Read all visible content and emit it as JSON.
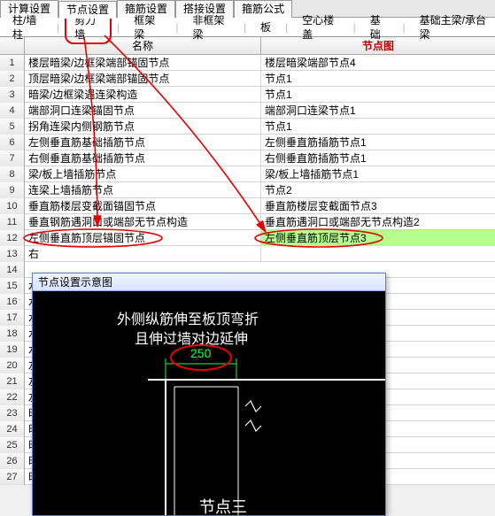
{
  "top_tabs": [
    "计算设置",
    "节点设置",
    "箍筋设置",
    "搭接设置",
    "箍筋公式"
  ],
  "top_active_index": 1,
  "sub_tabs": [
    "柱/墙柱",
    "剪力墙",
    "框架梁",
    "非框架梁",
    "板",
    "空心楼盖",
    "基础",
    "基础主梁/承台梁"
  ],
  "sub_active_index": 1,
  "grid": {
    "header_name": "名称",
    "header_node": "节点图",
    "rows": [
      {
        "n": 1,
        "name": "楼层暗梁/边框梁端部锚固节点",
        "node": "楼层暗梁端部节点4"
      },
      {
        "n": 2,
        "name": "顶层暗梁/边框梁端部锚固节点",
        "node": "节点1"
      },
      {
        "n": 3,
        "name": "暗梁/边框梁遇连梁构造",
        "node": "节点1"
      },
      {
        "n": 4,
        "name": "端部洞口连梁锚固节点",
        "node": "端部洞口连梁节点1"
      },
      {
        "n": 5,
        "name": "拐角连梁内侧钢筋节点",
        "node": "节点1"
      },
      {
        "n": 6,
        "name": "左侧垂直筋基础插筋节点",
        "node": "左侧垂直筋插筋节点1"
      },
      {
        "n": 7,
        "name": "右侧垂直筋基础插筋节点",
        "node": "右侧垂直筋插筋节点1"
      },
      {
        "n": 8,
        "name": "梁/板上墙插筋节点",
        "node": "梁/板上墙插筋节点1"
      },
      {
        "n": 9,
        "name": "连梁上墙插筋节点",
        "node": "节点2"
      },
      {
        "n": 10,
        "name": "垂直筋楼层变截面锚固节点",
        "node": "垂直筋楼层变截面节点3"
      },
      {
        "n": 11,
        "name": "垂直钢筋遇洞口或端部无节点构造",
        "node": "垂直筋遇洞口或端部无节点构造2"
      },
      {
        "n": 12,
        "name": "左侧垂直筋顶层锚固节点",
        "node": "左侧垂直筋顶层节点3"
      },
      {
        "n": 13,
        "name": "右",
        "node": ""
      },
      {
        "n": 14,
        "name": "",
        "node": ""
      },
      {
        "n": 15,
        "name": "水",
        "node": ""
      },
      {
        "n": 16,
        "name": "水",
        "node": ""
      },
      {
        "n": 17,
        "name": "水",
        "node": ""
      },
      {
        "n": 18,
        "name": "水",
        "node": ""
      },
      {
        "n": 19,
        "name": "水",
        "node": ""
      },
      {
        "n": 20,
        "name": "左",
        "node": ""
      },
      {
        "n": 21,
        "name": "左",
        "node": ""
      },
      {
        "n": 22,
        "name": "左",
        "node": ""
      },
      {
        "n": 23,
        "name": "时",
        "node": ""
      },
      {
        "n": 24,
        "name": "时",
        "node": ""
      },
      {
        "n": 25,
        "name": "时",
        "node": ""
      },
      {
        "n": 26,
        "name": "时",
        "node": ""
      },
      {
        "n": 27,
        "name": "时",
        "node": ""
      }
    ],
    "selected_row": 12
  },
  "popup": {
    "title": "节点设置示意图",
    "line1": "外侧纵筋伸至板顶弯折",
    "line2": "且伸过墙对边延伸",
    "dim": "250",
    "caption": "节点三"
  }
}
